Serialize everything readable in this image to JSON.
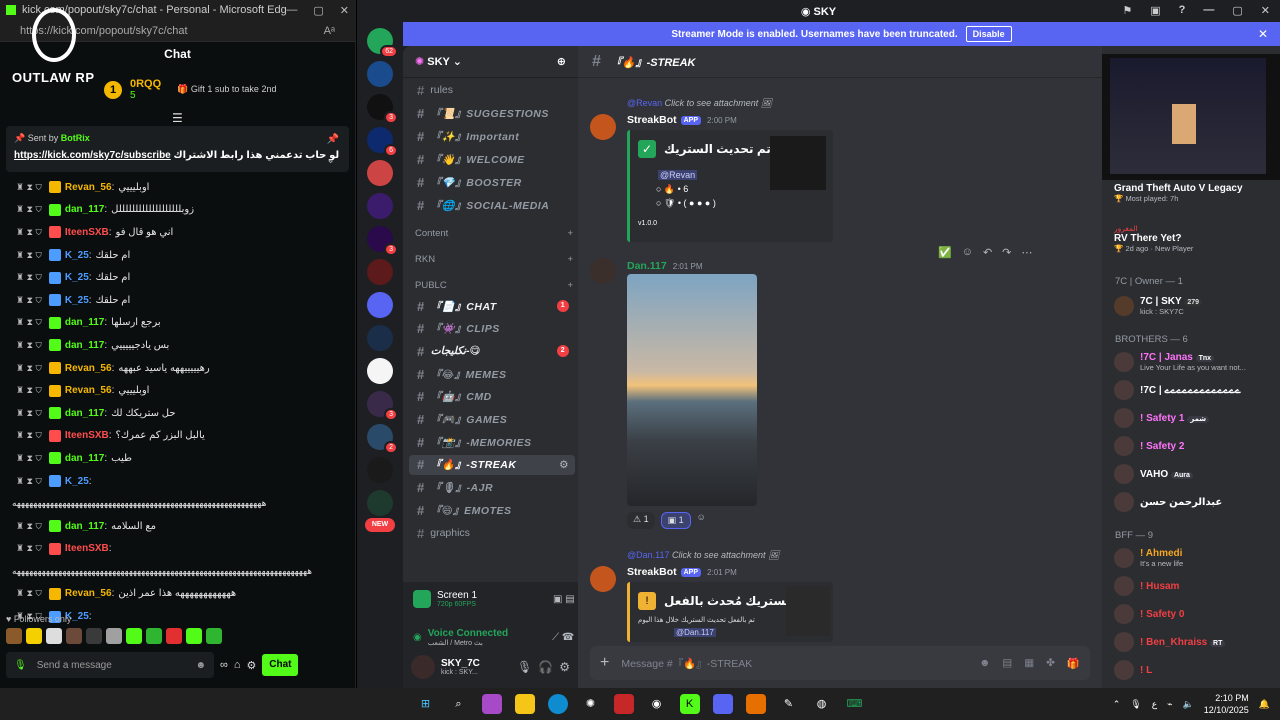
{
  "kick": {
    "window_title": "kick.com/popout/sky7c/chat - Personal - Microsoft Edge",
    "url": "https://kick.com/popout/sky7c/chat",
    "chat_title": "Chat",
    "logo_text": "OUTLAW RP",
    "leaderboard": {
      "rank": "1",
      "name": "0RQQ",
      "count": "5",
      "gift_text": "Gift 1 sub to take 2nd"
    },
    "pinned": {
      "sent_by_prefix": "Sent by",
      "sent_by_user": "BotRix",
      "link": "https://kick.com/sky7c/subscribe",
      "text": "لو حاب تدعمني هذا رابط الاشتراك"
    },
    "messages": [
      {
        "user": "Revan_56",
        "color": "#f5b700",
        "text": "اوبليييي"
      },
      {
        "user": "dan_117",
        "color": "#53fc18",
        "text": "زوبلللللللللللللللللللل"
      },
      {
        "user": "IteenSXB",
        "color": "#ff4d4d",
        "text": "اني هو قال فو"
      },
      {
        "user": "K_25",
        "color": "#4d9cff",
        "text": "ام حلقك"
      },
      {
        "user": "K_25",
        "color": "#4d9cff",
        "text": "ام حلقك"
      },
      {
        "user": "K_25",
        "color": "#4d9cff",
        "text": "ام حلقك"
      },
      {
        "user": "dan_117",
        "color": "#53fc18",
        "text": "برجع ارسلها"
      },
      {
        "user": "dan_117",
        "color": "#53fc18",
        "text": "بس يادجيييييي"
      },
      {
        "user": "Revan_56",
        "color": "#f5b700",
        "text": "رهيييييههه ياسيد عبههه"
      },
      {
        "user": "Revan_56",
        "color": "#f5b700",
        "text": "اوبليييي"
      },
      {
        "user": "dan_117",
        "color": "#53fc18",
        "text": "حل ستريكك لك"
      },
      {
        "user": "IteenSXB",
        "color": "#ff4d4d",
        "text": "يالبل البزر كم عمرك؟"
      },
      {
        "user": "dan_117",
        "color": "#53fc18",
        "text": "طيب"
      },
      {
        "user": "K_25",
        "color": "#4d9cff",
        "text": ""
      },
      {
        "long": "ههههههههههههههههههههههههههههههههههههههههههههههههههههههههههههه"
      },
      {
        "user": "dan_117",
        "color": "#53fc18",
        "text": "مع السلامه"
      },
      {
        "user": "IteenSXB",
        "color": "#ff4d4d",
        "text": ""
      },
      {
        "long": "هههههههههههههههههههههههههههههههههههههههههههههههههههههههههههههههههههههههه"
      },
      {
        "user": "Revan_56",
        "color": "#f5b700",
        "text": "ههههههههههههه هذا عمر اذين"
      },
      {
        "user": "K_25",
        "color": "#4d9cff",
        "text": ""
      }
    ],
    "followers_only": "Followers only",
    "send_placeholder": "Send a message",
    "chat_button": "Chat"
  },
  "discord": {
    "title": "SKY",
    "banner": {
      "text": "Streamer Mode is enabled. Usernames have been truncated.",
      "button": "Disable"
    },
    "server_name": "SKY",
    "guild_badges": [
      "62",
      "",
      "3",
      "6",
      "",
      "",
      "3",
      "",
      "",
      "",
      "",
      "3",
      "2",
      "",
      "",
      "",
      "",
      "",
      "",
      "NEW"
    ],
    "channels": [
      {
        "name": "rules",
        "plain": true
      },
      {
        "name": "『📜』SUGGESTIONS"
      },
      {
        "name": "『✨』Important"
      },
      {
        "name": "『👋』WELCOME"
      },
      {
        "name": "『💎』BOOSTER"
      },
      {
        "name": "『🌐』SOCIAL-MEDIA"
      }
    ],
    "categories": {
      "content": "Content",
      "rkn": "RKN",
      "public": "PUBLC"
    },
    "public_channels": [
      {
        "name": "『📄』CHAT",
        "unread": "1"
      },
      {
        "name": "『👾』CLIPS"
      },
      {
        "name": "نكليجات-😋",
        "unread": "2"
      },
      {
        "name": "『😂』MEMES"
      },
      {
        "name": "『🤖』CMD"
      },
      {
        "name": "『🎮』GAMES"
      },
      {
        "name": "『📸』-MEMORIES"
      },
      {
        "name": "『🔥』-STREAK",
        "selected": true
      },
      {
        "name": "『🎙』-AJR"
      },
      {
        "name": "『😄』EMOTES"
      },
      {
        "name": "graphics",
        "plain": true
      }
    ],
    "screen": {
      "title": "Screen 1",
      "sub": "720p 60FPS"
    },
    "voice": {
      "title": "Voice Connected",
      "sub": "الشعب / Metro بث"
    },
    "user": {
      "name": "SKY_7C",
      "status": "kick : SKY..."
    },
    "channel_header": "『🔥』-STREAK",
    "messages": {
      "reply1_user": "@Revan",
      "reply1_text": "Click to see attachment",
      "bot_name": "StreakBot",
      "app_tag": "APP",
      "time1": "2:00 PM",
      "embed1_title": "تم تحديث الستريك •",
      "embed1_mention": "@Revan",
      "embed1_count": "6",
      "embed1_footer": "v1.0.0",
      "user2": "Dan.117",
      "time2": "2:01 PM",
      "reaction1": "1",
      "reaction2": "1",
      "reply2_user": "@Dan.117",
      "reply2_text": "Click to see attachment",
      "time3": "2:01 PM",
      "embed2_title": "الستريك مُحدث بالفعل •",
      "embed2_text": "تم بالفعل تحديث الستريك خلال هذا اليوم",
      "embed2_mention": "@Dan.117"
    },
    "composer_placeholder": "Message #『🔥』-STREAK",
    "members": {
      "activity1": {
        "title": "Grand Theft Auto V Legacy",
        "sub": "Most played: 7h"
      },
      "activity2": {
        "user": "المغرور",
        "title": "RV There Yet?",
        "sub": "2d ago · New Player"
      },
      "owner_header": "7C | Owner — 1",
      "owner": {
        "name": "7C | SKY",
        "tag": "279",
        "sub": "kick : SKY7C"
      },
      "brothers_header": "BROTHERS — 6",
      "brothers": [
        {
          "name": "!7C | Janas",
          "tag": "Tnx",
          "sub": "Live Your Life as you want not...",
          "color": "#ff73fa"
        },
        {
          "name": "!7C | ےےےےےےےےےےےےے",
          "color": "#ffffff"
        },
        {
          "name": "! Safety 1",
          "tag": "شمر",
          "color": "#ff73fa"
        },
        {
          "name": "! Safety 2",
          "color": "#ff73fa"
        },
        {
          "name": "VAHO",
          "tag": "Aura",
          "color": "#ffffff"
        },
        {
          "name": "عبدالرحمن حسن",
          "color": "#ffffff"
        }
      ],
      "bff_header": "BFF — 9",
      "bff": [
        {
          "name": "! Ahmedi",
          "sub": "It's a new life",
          "color": "#f5a623"
        },
        {
          "name": "! Husam",
          "color": "#f23f43"
        },
        {
          "name": "! Safety 0",
          "color": "#f23f43"
        },
        {
          "name": "! Ben_Khraiss",
          "tag": "RT",
          "color": "#f23f43"
        },
        {
          "name": "! L",
          "color": "#f23f43"
        }
      ]
    }
  },
  "taskbar": {
    "time": "2:10 PM",
    "date": "12/10/2025",
    "lang": "ع"
  }
}
